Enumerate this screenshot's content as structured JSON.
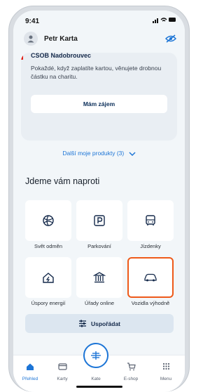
{
  "status_bar": {
    "time": "9:41",
    "signal_icons": ".ıl ᯤ ▬"
  },
  "profile": {
    "name": "Petr Karta",
    "avatar_icon": "person-icon",
    "visibility_icon": "eye-off-icon"
  },
  "charity": {
    "title": "CSOB Nadobrouvec",
    "description": "Pokaždé, když zaplatíte kartou, věnujete drobnou částku na charitu.",
    "button_label": "Mám zájem"
  },
  "more_products": {
    "label": "Další moje produkty (3)",
    "icon": "chevron-down-icon"
  },
  "section": {
    "title": "Jdeme vám naproti",
    "tiles": [
      {
        "label": "Svět odměn",
        "icon": "globe-icon"
      },
      {
        "label": "Parkování",
        "icon": "parking-icon"
      },
      {
        "label": "Jízdenky",
        "icon": "bus-icon"
      },
      {
        "label": "Úspory energií",
        "icon": "house-energy-icon"
      },
      {
        "label": "Úřady online",
        "icon": "government-building-icon"
      },
      {
        "label": "Vozidla výhodně",
        "icon": "car-icon"
      }
    ],
    "reorder_label": "Uspořádat"
  },
  "bottom_nav": {
    "items": [
      {
        "label": "Přehled",
        "icon": "home-icon"
      },
      {
        "label": "Karty",
        "icon": "card-icon"
      },
      {
        "label": "Kate",
        "icon": "kate-assistant-icon"
      },
      {
        "label": "E-shop",
        "icon": "cart-icon"
      },
      {
        "label": "Menu",
        "icon": "grid-menu-icon"
      }
    ]
  },
  "colors": {
    "accent": "#1d75d6",
    "highlight": "#ee5a1a",
    "brand_red": "#e2231a",
    "navy": "#14294a"
  }
}
